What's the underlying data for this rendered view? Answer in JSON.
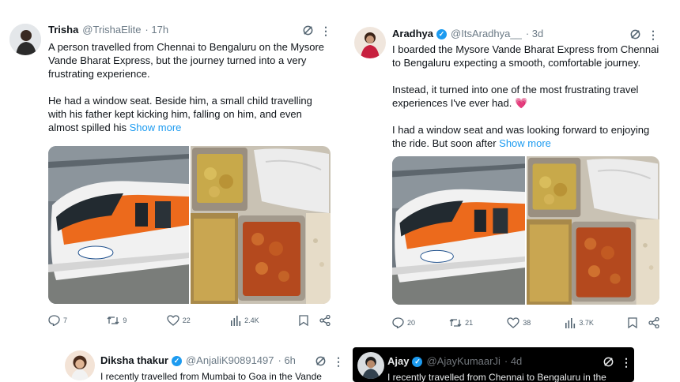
{
  "tweets": [
    {
      "name": "Trisha",
      "handle": "@TrishaElite",
      "time": "· 17h",
      "verified": false,
      "paragraphs": [
        "A person travelled from Chennai to Bengaluru on the Mysore Vande Bharat Express, but the journey turned into a very frustrating experience.",
        "He had a window seat. Beside him, a small child travelling with his father kept kicking him, falling on him, and even almost spilled his"
      ],
      "show_more": "Show more",
      "stats": {
        "replies": "7",
        "reposts": "9",
        "likes": "22",
        "views": "2.4K"
      }
    },
    {
      "name": "Aradhya",
      "handle": "@ItsAradhya__",
      "time": "· 3d",
      "verified": true,
      "paragraphs": [
        "I boarded the Mysore Vande Bharat Express from Chennai to Bengaluru expecting a smooth, comfortable journey.",
        "Instead, it turned into one of the most frustrating travel experiences I've ever had. 💗",
        "I had a window seat and was looking forward to enjoying the ride. But soon after"
      ],
      "show_more": "Show more",
      "stats": {
        "replies": "20",
        "reposts": "21",
        "likes": "38",
        "views": "3.7K"
      }
    },
    {
      "name": "Diksha thakur",
      "handle": "@AnjaliK90891497",
      "time": "· 6h",
      "verified": true,
      "paragraphs": [
        "I recently travelled from Mumbai to Goa in the Vande"
      ]
    },
    {
      "name": "Ajay",
      "handle": "@AjayKumaarJi",
      "time": "· 4d",
      "verified": true,
      "paragraphs": [
        "I recently travelled from Chennai to Bengaluru in the"
      ]
    }
  ],
  "icons": {
    "verified": "✓",
    "more": "⋮"
  },
  "colors": {
    "link": "#1d9bf0",
    "train_orange": "#ec6a1c",
    "dark_card": "#000000"
  }
}
